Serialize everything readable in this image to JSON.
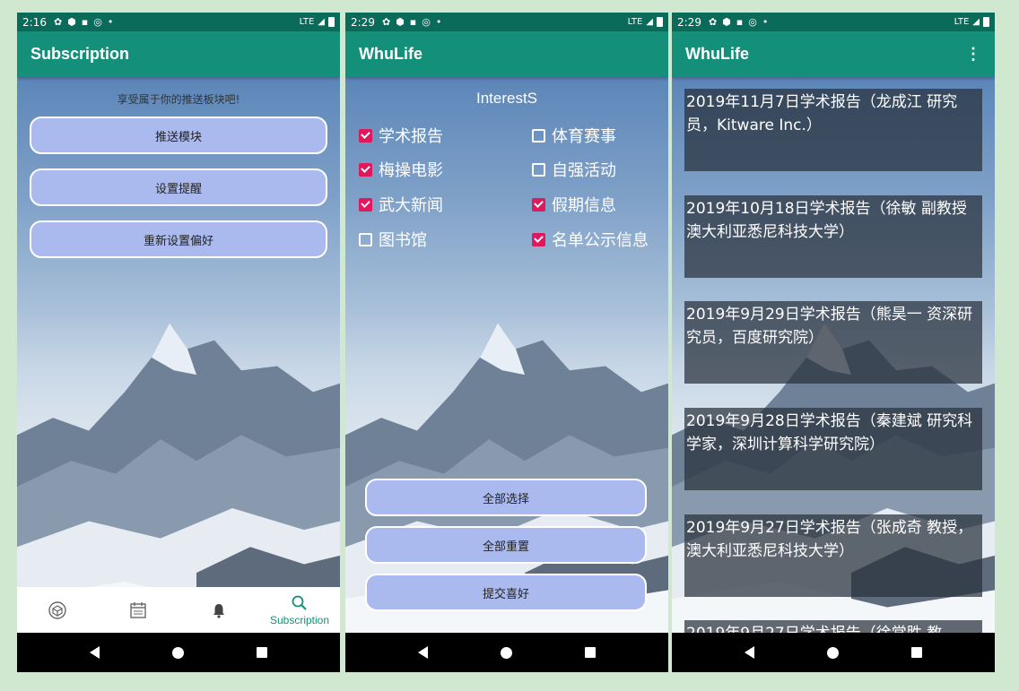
{
  "phone1": {
    "status": {
      "time": "2:16",
      "network": "LTE"
    },
    "appbar_title": "Subscription",
    "heading": "享受属于你的推送板块吧!",
    "buttons": [
      "推送模块",
      "设置提醒",
      "重新设置偏好"
    ],
    "bottom_nav": {
      "items": [
        {
          "icon": "cube-icon"
        },
        {
          "icon": "calendar-icon"
        },
        {
          "icon": "bell-icon"
        },
        {
          "icon": "search-icon",
          "label": "Subscription",
          "active": true
        }
      ],
      "active_color": "#14907a"
    }
  },
  "phone2": {
    "status": {
      "time": "2:29",
      "network": "LTE"
    },
    "appbar_title": "WhuLife",
    "title": "InterestS",
    "checkboxes": [
      {
        "label": "学术报告",
        "checked": true
      },
      {
        "label": "体育赛事",
        "checked": false
      },
      {
        "label": "梅操电影",
        "checked": true
      },
      {
        "label": "自强活动",
        "checked": false
      },
      {
        "label": "武大新闻",
        "checked": true
      },
      {
        "label": "假期信息",
        "checked": true
      },
      {
        "label": "图书馆",
        "checked": false
      },
      {
        "label": "名单公示信息",
        "checked": true
      }
    ],
    "buttons": [
      "全部选择",
      "全部重置",
      "提交喜好"
    ],
    "check_color": "#e0195e"
  },
  "phone3": {
    "status": {
      "time": "2:29",
      "network": "LTE"
    },
    "appbar_title": "WhuLife",
    "menu_icon": "more-vert-icon",
    "reports": [
      "2019年11月7日学术报告（龙成江 研究员，Kitware Inc.）",
      "2019年10月18日学术报告（徐敏 副教授 澳大利亚悉尼科技大学）",
      "2019年9月29日学术报告（熊昊一 资深研究员，百度研究院）",
      "2019年9月28日学术报告（秦建斌 研究科学家，深圳计算科学研究院）",
      "2019年9月27日学术报告（张成奇 教授，澳大利亚悉尼科技大学）",
      "2019年9月27日学术报告（徐常胜 教"
    ]
  },
  "colors": {
    "appbar": "#14907a",
    "statusbar": "#0b6b5a",
    "pill": "#aab9ee",
    "background": "#cfe8cf"
  }
}
